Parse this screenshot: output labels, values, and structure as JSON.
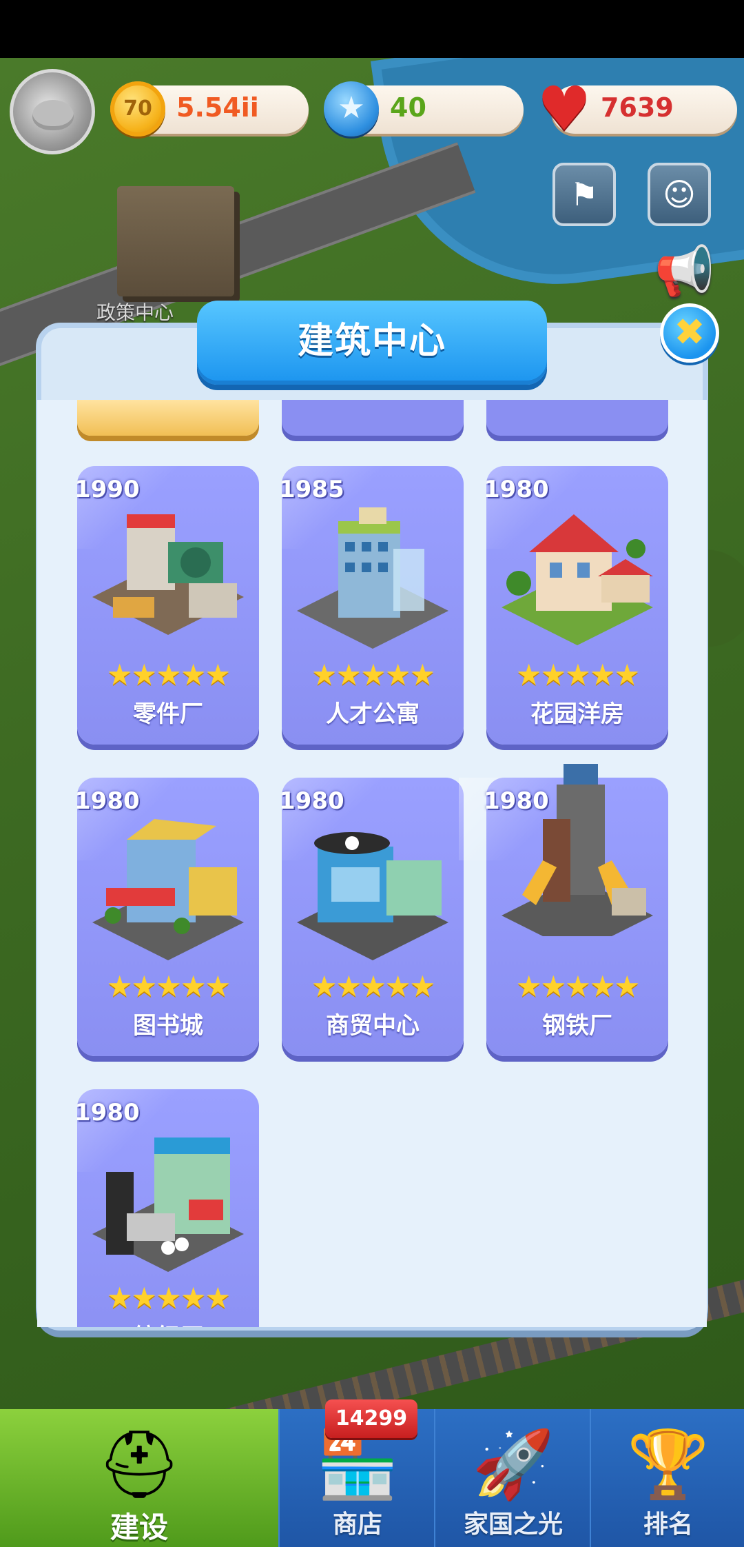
{
  "hud": {
    "coins": "5.54ii",
    "coin_symbol": "70",
    "stars": "40",
    "hearts": "7639",
    "bg_building_label": "政策中心"
  },
  "modal": {
    "title": "建筑中心",
    "close_symbol": "✖"
  },
  "buildings": [
    {
      "year": "1990",
      "name": "零件厂",
      "stars": "★★★★★"
    },
    {
      "year": "1985",
      "name": "人才公寓",
      "stars": "★★★★★"
    },
    {
      "year": "1980",
      "name": "花园洋房",
      "stars": "★★★★★"
    },
    {
      "year": "1980",
      "name": "图书城",
      "stars": "★★★★★"
    },
    {
      "year": "1980",
      "name": "商贸中心",
      "stars": "★★★★★"
    },
    {
      "year": "1980",
      "name": "钢铁厂",
      "stars": "★★★★★"
    },
    {
      "year": "1980",
      "name": "纺织厂",
      "stars": "★★★★★"
    }
  ],
  "bottom_nav": {
    "shop_badge": "14299",
    "items": [
      {
        "label": "建设",
        "icon": "hardhat-icon"
      },
      {
        "label": "商店",
        "icon": "shop-icon"
      },
      {
        "label": "家国之光",
        "icon": "rocket-icon"
      },
      {
        "label": "排名",
        "icon": "trophy-icon"
      }
    ]
  },
  "colors": {
    "card": "#8a8ff2",
    "title_banner": "#1b94ef",
    "nav_active": "#6fbd2a",
    "nav": "#2463b4"
  }
}
